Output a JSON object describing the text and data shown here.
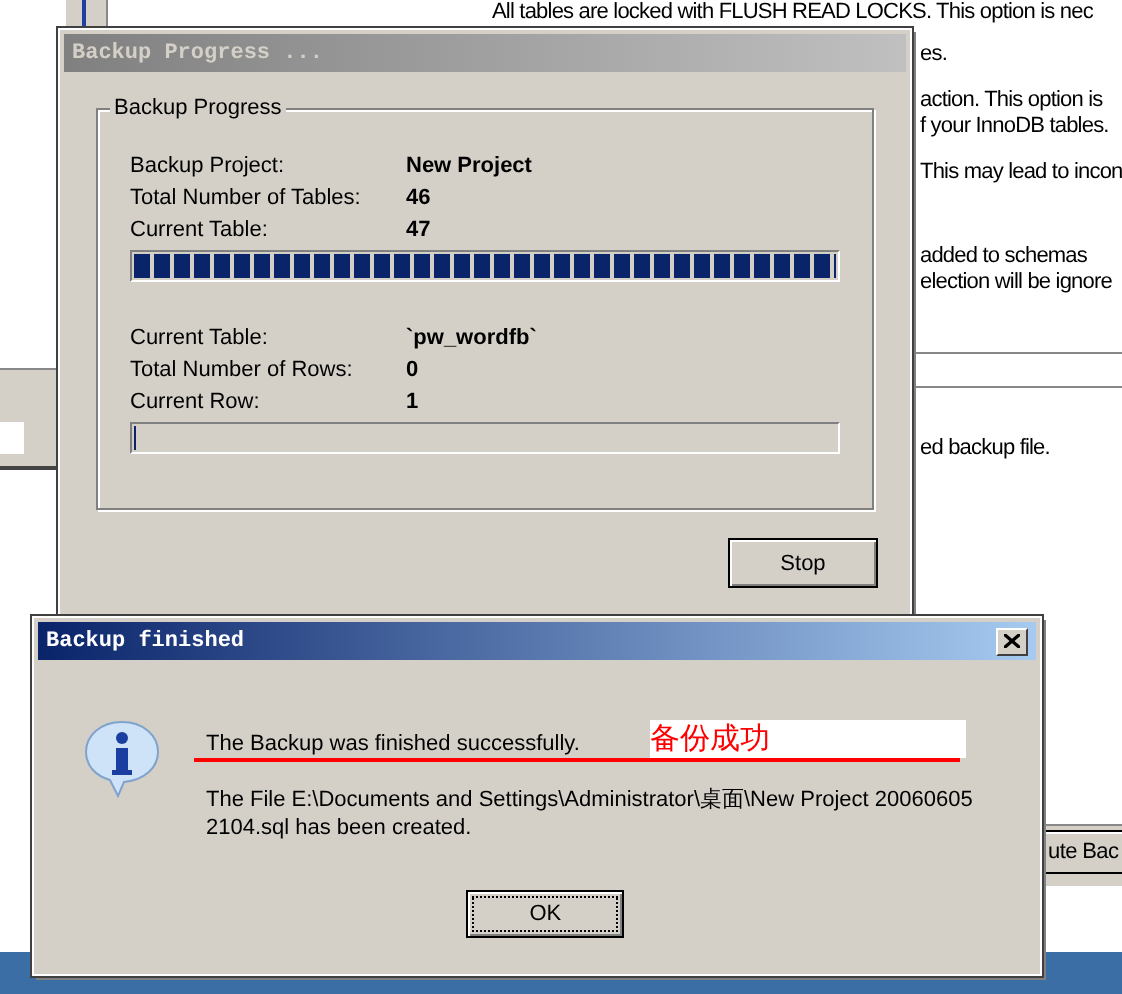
{
  "background_app": {
    "texts": [
      {
        "text": "All tables are locked with FLUSH READ LOCKS. This option is nec"
      },
      {
        "text": "es."
      },
      {
        "text": "action. This option is"
      },
      {
        "text": "f your InnoDB tables."
      },
      {
        "text": "This may lead to incon"
      },
      {
        "text": "added to schemas"
      },
      {
        "text": "election will be ignore"
      },
      {
        "text": "ed backup file."
      }
    ],
    "button": "ute Bac"
  },
  "progress_dialog": {
    "title": "Backup Progress ...",
    "active": false,
    "group_title": "Backup Progress",
    "sections": [
      {
        "rows": [
          {
            "label": "Backup Project:",
            "value": "New Project"
          },
          {
            "label": "Total Number of Tables:",
            "value": "46"
          },
          {
            "label": "Current Table:",
            "value": "47"
          }
        ],
        "level": 1
      },
      {
        "rows": [
          {
            "label": "Current Table:",
            "value": "`pw_wordfb`"
          },
          {
            "label": "Total Number of Rows:",
            "value": "0"
          },
          {
            "label": "Current Row:",
            "value": "1"
          }
        ],
        "level": 0
      }
    ],
    "stop_button": "Stop"
  },
  "finished_dialog": {
    "title": "Backup finished",
    "active": true,
    "message": "The Backup was finished successfully.",
    "annotation": "备份成功",
    "detail": "The File E:\\Documents and Settings\\Administrator\\桌面\\New Project 20060605\n2104.sql has been created.",
    "ok_button": "OK"
  }
}
